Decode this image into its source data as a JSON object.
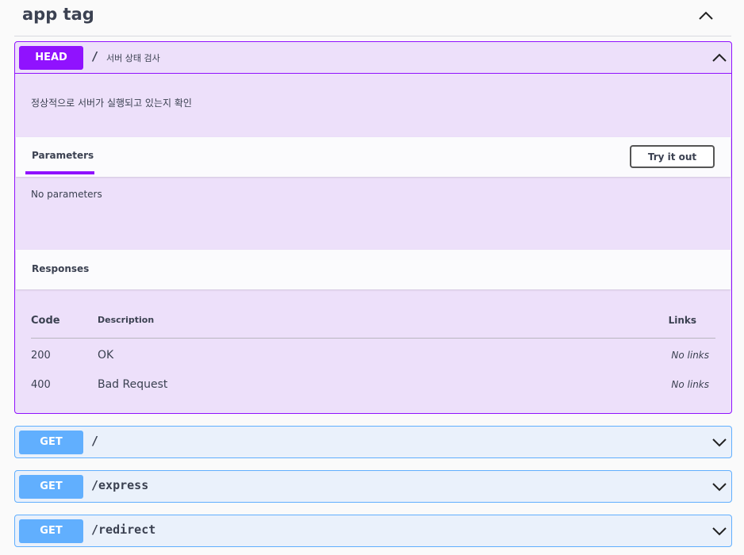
{
  "tag": {
    "title": "app tag",
    "toggle_icon": "chevron-up-icon"
  },
  "head_op": {
    "method": "HEAD",
    "path": "/",
    "summary": "서버 상태 검사",
    "description": "정상적으로 서버가 실행되고 있는지 확인",
    "parameters_tab": "Parameters",
    "try_it_out": "Try it out",
    "no_parameters": "No parameters",
    "responses_title": "Responses",
    "columns": {
      "code": "Code",
      "description": "Description",
      "links": "Links"
    },
    "responses": [
      {
        "code": "200",
        "description": "OK",
        "links": "No links"
      },
      {
        "code": "400",
        "description": "Bad Request",
        "links": "No links"
      }
    ]
  },
  "get_ops": [
    {
      "method": "GET",
      "path": "/"
    },
    {
      "method": "GET",
      "path": "/express"
    },
    {
      "method": "GET",
      "path": "/redirect"
    }
  ],
  "colors": {
    "head": "#9012fe",
    "head_bg": "#ede0fa",
    "get": "#61affe",
    "get_bg": "#eaf1fb"
  }
}
